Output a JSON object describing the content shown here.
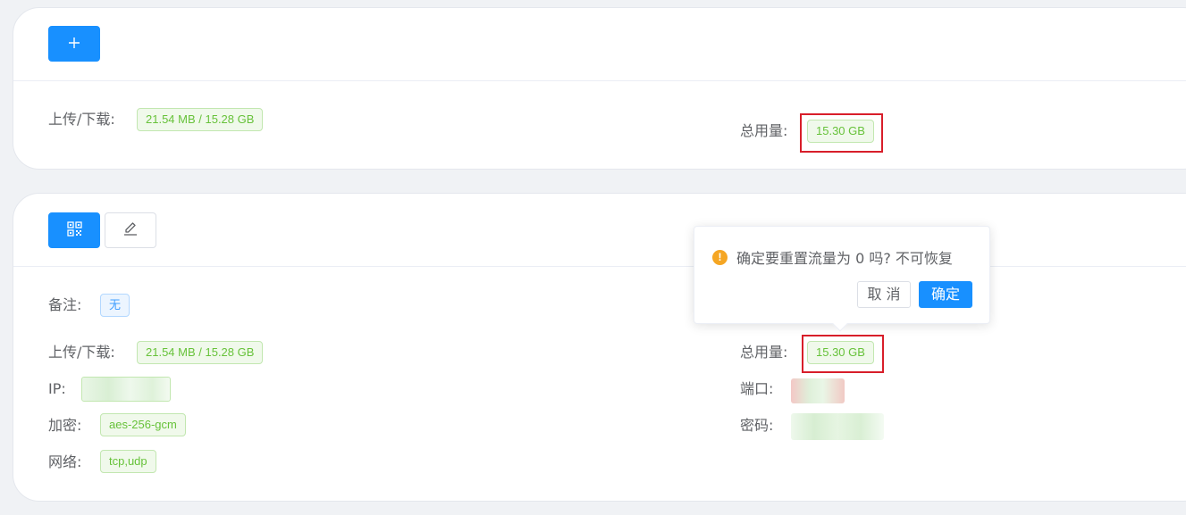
{
  "card1": {
    "add_button_icon": "plus-icon",
    "upload_download_label": "上传/下载:",
    "upload_download_value": "21.54 MB / 15.28 GB",
    "total_label": "总用量:",
    "total_value": "15.30 GB"
  },
  "card2": {
    "qr_button_icon": "qrcode-icon",
    "edit_button_icon": "edit-icon",
    "remark_label": "备注:",
    "remark_value": "无",
    "upload_download_label": "上传/下载:",
    "upload_download_value": "21.54 MB / 15.28 GB",
    "total_label": "总用量:",
    "total_value": "15.30 GB",
    "ip_label": "IP:",
    "port_label": "端口:",
    "encryption_label": "加密:",
    "encryption_value": "aes-256-gcm",
    "password_label": "密码:",
    "network_label": "网络:",
    "network_value": "tcp,udp"
  },
  "popover": {
    "icon": "warning-icon",
    "icon_glyph": "!",
    "message": "确定要重置流量为 0 吗? 不可恢复",
    "cancel_label": "取 消",
    "confirm_label": "确定"
  },
  "colors": {
    "primary": "#1890ff",
    "success_text": "#67c23a",
    "highlight_box": "#d81e2a",
    "warning": "#f5a623"
  }
}
